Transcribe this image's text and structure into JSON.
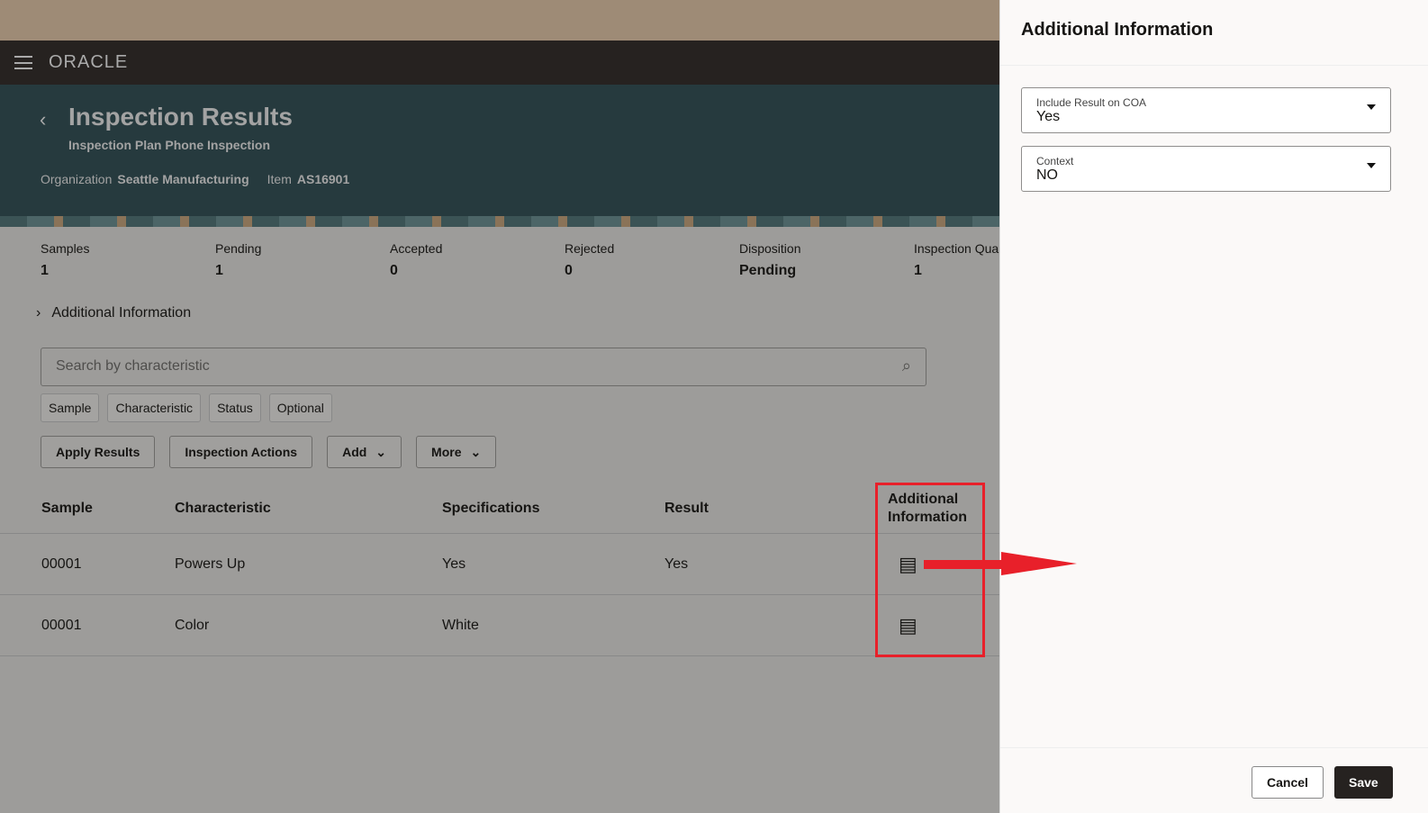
{
  "header": {
    "logo": "ORACLE",
    "back": "‹",
    "title": "Inspection Results",
    "subtitle": "Inspection Plan Phone Inspection",
    "org_label": "Organization",
    "org_value": "Seattle Manufacturing",
    "item_label": "Item",
    "item_value": "AS16901"
  },
  "stats": [
    {
      "label": "Samples",
      "value": "1"
    },
    {
      "label": "Pending",
      "value": "1"
    },
    {
      "label": "Accepted",
      "value": "0"
    },
    {
      "label": "Rejected",
      "value": "0"
    },
    {
      "label": "Disposition",
      "value": "Pending"
    },
    {
      "label": "Inspection Qua",
      "value": "1"
    }
  ],
  "additional_info_toggle": "Additional Information",
  "search": {
    "placeholder": "Search by characteristic"
  },
  "filters": [
    "Sample",
    "Characteristic",
    "Status",
    "Optional"
  ],
  "actions": {
    "apply": "Apply Results",
    "inspection": "Inspection Actions",
    "add": "Add",
    "more": "More"
  },
  "table": {
    "headers": [
      "Sample",
      "Characteristic",
      "Specifications",
      "Result",
      "Additional Information"
    ],
    "rows": [
      [
        "00001",
        "Powers Up",
        "Yes",
        "Yes"
      ],
      [
        "00001",
        "Color",
        "White",
        ""
      ]
    ]
  },
  "panel": {
    "title": "Additional Information",
    "fields": [
      {
        "label": "Include Result on COA",
        "value": "Yes"
      },
      {
        "label": "Context",
        "value": "NO"
      }
    ],
    "cancel": "Cancel",
    "save": "Save"
  },
  "colors": {
    "highlight": "#e8202a",
    "header": "#262220",
    "hero": "#263a3e"
  }
}
